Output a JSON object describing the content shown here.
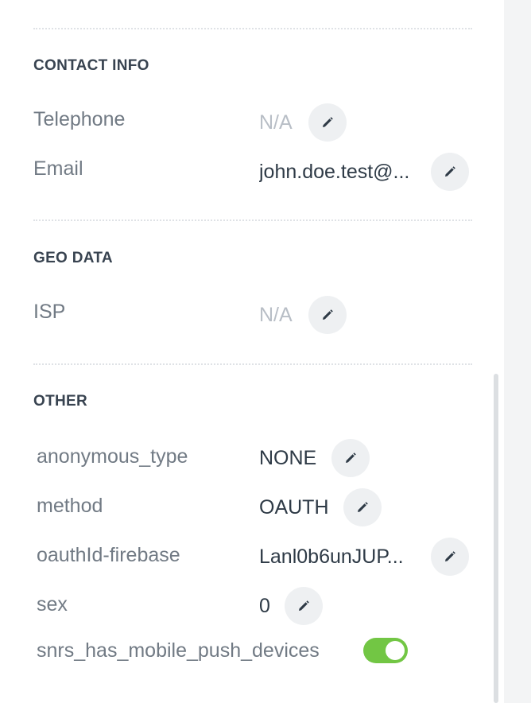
{
  "sections": {
    "contact": {
      "title": "CONTACT INFO",
      "telephone": {
        "label": "Telephone",
        "value": "N/A"
      },
      "email": {
        "label": "Email",
        "value": "john.doe.test@..."
      }
    },
    "geo": {
      "title": "GEO DATA",
      "isp": {
        "label": "ISP",
        "value": "N/A"
      }
    },
    "other": {
      "title": "OTHER",
      "anonymous_type": {
        "label": "anonymous_type",
        "value": "NONE"
      },
      "method": {
        "label": "method",
        "value": "OAUTH"
      },
      "oauthid": {
        "label": "oauthId-firebase",
        "value": "Lanl0b6unJUP..."
      },
      "sex": {
        "label": "sex",
        "value": "0"
      },
      "push": {
        "label": "snrs_has_mobile_push_devices",
        "enabled": true
      }
    }
  },
  "colors": {
    "toggle_on": "#72c644",
    "section_title": "#384350",
    "label": "#717a84",
    "value": "#2e3a46",
    "na": "#b8bec6"
  },
  "icons": {
    "edit": "pencil-icon"
  }
}
